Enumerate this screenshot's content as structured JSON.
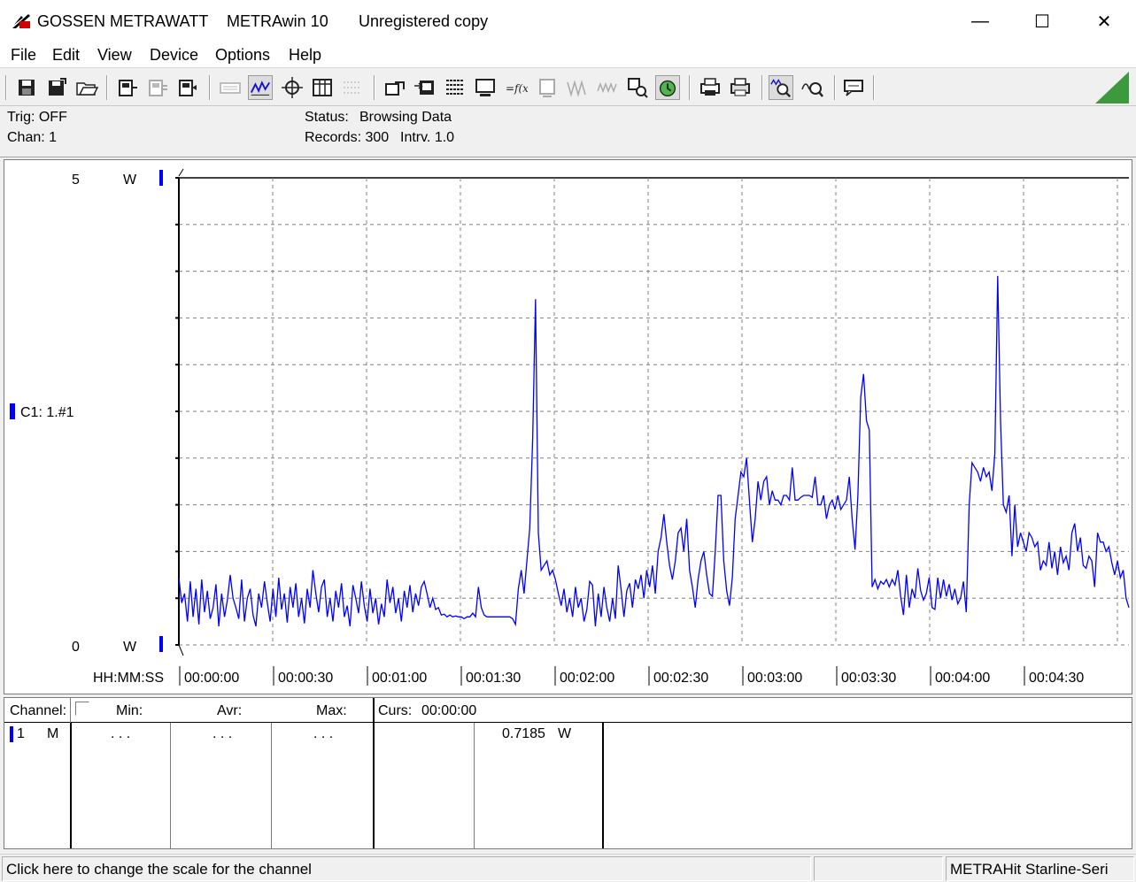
{
  "titlebar": {
    "brand": "GOSSEN METRAWATT",
    "app": "METRAwin 10",
    "registration": "Unregistered copy",
    "min_glyph": "—",
    "max_glyph": "☐",
    "close_glyph": "✕"
  },
  "menu": [
    "File",
    "Edit",
    "View",
    "Device",
    "Options",
    "Help"
  ],
  "info": {
    "trig": "Trig: OFF",
    "chan": "Chan:  1",
    "status_label": "Status:",
    "status_value": "Browsing Data",
    "records": "Records: 300",
    "interval": "Intrv. 1.0"
  },
  "chart": {
    "y_top_label": "5",
    "y_bottom_label": "0",
    "y_unit": "W",
    "channel_label": "C1: 1.#1",
    "x_axis_label": "HH:MM:SS"
  },
  "chart_data": {
    "type": "line",
    "ylabel": "W",
    "ylim": [
      0,
      5
    ],
    "xlim": [
      0,
      300
    ],
    "grid": true,
    "x_tick_labels": [
      "00:00:00",
      "00:00:30",
      "00:01:00",
      "00:01:30",
      "00:02:00",
      "00:02:30",
      "00:03:00",
      "00:03:30",
      "00:04:00",
      "00:04:30"
    ],
    "series": [
      {
        "name": "C1: 1.#1",
        "color": "#0000ff",
        "values": [
          0.72,
          0.45,
          0.55,
          0.25,
          0.68,
          0.3,
          0.6,
          0.22,
          0.7,
          0.35,
          0.58,
          0.28,
          0.4,
          0.65,
          0.2,
          0.55,
          0.3,
          0.48,
          0.75,
          0.5,
          0.4,
          0.28,
          0.7,
          0.25,
          0.5,
          0.6,
          0.32,
          0.2,
          0.55,
          0.4,
          0.68,
          0.45,
          0.25,
          0.6,
          0.3,
          0.72,
          0.38,
          0.55,
          0.24,
          0.62,
          0.4,
          0.66,
          0.3,
          0.5,
          0.23,
          0.6,
          0.4,
          0.8,
          0.55,
          0.35,
          0.62,
          0.7,
          0.3,
          0.5,
          0.25,
          0.58,
          0.4,
          0.66,
          0.3,
          0.42,
          0.2,
          0.64,
          0.5,
          0.34,
          0.68,
          0.42,
          0.25,
          0.6,
          0.34,
          0.5,
          0.22,
          0.44,
          0.3,
          0.7,
          0.45,
          0.62,
          0.34,
          0.5,
          0.25,
          0.58,
          0.4,
          0.64,
          0.35,
          0.55,
          0.42,
          0.62,
          0.68,
          0.55,
          0.4,
          0.5,
          0.38,
          0.4,
          0.32,
          0.33,
          0.3,
          0.32,
          0.3,
          0.31,
          0.3,
          0.3,
          0.28,
          0.3,
          0.3,
          0.34,
          0.3,
          0.62,
          0.4,
          0.32,
          0.3,
          0.3,
          0.3,
          0.3,
          0.3,
          0.3,
          0.3,
          0.3,
          0.3,
          0.28,
          0.22,
          0.6,
          0.8,
          0.55,
          0.9,
          1.25,
          2.2,
          3.7,
          1.2,
          0.8,
          0.85,
          0.9,
          0.75,
          0.8,
          0.7,
          0.55,
          0.42,
          0.6,
          0.35,
          0.5,
          0.3,
          0.62,
          0.4,
          0.5,
          0.25,
          0.38,
          0.68,
          0.64,
          0.2,
          0.55,
          0.3,
          0.62,
          0.4,
          0.25,
          0.5,
          0.28,
          0.85,
          0.6,
          0.3,
          0.58,
          0.66,
          0.4,
          0.7,
          0.6,
          0.75,
          0.5,
          0.8,
          0.62,
          0.85,
          0.55,
          1.0,
          1.15,
          1.4,
          1.1,
          0.85,
          0.7,
          0.9,
          1.2,
          1.25,
          1.0,
          1.35,
          0.8,
          0.62,
          0.4,
          0.7,
          0.9,
          1.0,
          0.75,
          0.55,
          0.52,
          1.0,
          1.6,
          1.6,
          0.9,
          0.58,
          0.42,
          0.72,
          1.35,
          1.6,
          1.85,
          1.8,
          2.0,
          1.55,
          1.1,
          1.35,
          1.75,
          1.55,
          1.75,
          1.8,
          1.5,
          1.65,
          1.55,
          1.55,
          1.5,
          1.6,
          1.6,
          1.55,
          1.9,
          1.55,
          1.55,
          1.58,
          1.6,
          1.6,
          1.6,
          1.58,
          1.8,
          1.5,
          1.5,
          1.6,
          1.35,
          1.5,
          1.55,
          1.45,
          1.6,
          1.45,
          1.5,
          1.55,
          1.8,
          1.35,
          1.02,
          1.6,
          2.65,
          2.9,
          2.4,
          2.3,
          0.62,
          0.7,
          0.6,
          0.68,
          0.65,
          0.7,
          0.62,
          0.7,
          0.64,
          0.8,
          0.52,
          0.32,
          0.75,
          0.4,
          0.6,
          0.5,
          0.82,
          0.58,
          0.48,
          0.55,
          0.72,
          0.4,
          0.38,
          0.72,
          0.5,
          0.7,
          0.52,
          0.65,
          0.48,
          0.6,
          0.44,
          0.5,
          0.68,
          0.35,
          1.5,
          1.95,
          1.9,
          1.85,
          1.75,
          1.9,
          1.8,
          1.85,
          1.65,
          2.05,
          3.95,
          2.4,
          1.5,
          1.42,
          1.6,
          0.95,
          1.5,
          1.05,
          1.2,
          1.1,
          1.0,
          1.2,
          1.15,
          1.05,
          1.1,
          0.8,
          0.9,
          0.85,
          1.1,
          0.82,
          1.0,
          0.75,
          1.05,
          0.88,
          0.95,
          0.8,
          1.2,
          1.3,
          1.0,
          1.15,
          0.85,
          0.82,
          0.95,
          0.9,
          0.62,
          1.2,
          1.1,
          1.1,
          1.0,
          1.05,
          0.88,
          0.75,
          0.9,
          0.72,
          0.8,
          0.5,
          0.4
        ]
      }
    ]
  },
  "table": {
    "channel_header": "Channel:",
    "min_header": "Min:",
    "avr_header": "Avr:",
    "max_header": "Max:",
    "curs_header": "Curs:",
    "curs_time": "00:00:00",
    "row": {
      "channel": "1",
      "mode": "M",
      "min": ". . .",
      "avr": ". . .",
      "max": ". . .",
      "cursor_value": "0.7185",
      "cursor_unit": "W"
    }
  },
  "statusbar": {
    "hint": "Click here to change the scale for the channel",
    "empty": "",
    "device": "METRAHit Starline-Seri"
  },
  "colors": {
    "trace": "#0000ff",
    "grid": "#808080",
    "accent_triangle": "#3c9a3c"
  },
  "toolbar_icons": [
    "save-icon",
    "save-as-icon",
    "open-folder-icon",
    "device-read-icon",
    "device-disabled-icon",
    "device-write-icon",
    "keyboard-disabled-icon",
    "trace-mode-icon",
    "crosshair-icon",
    "table-view-icon",
    "grid-disabled-icon",
    "export-icon",
    "import-icon",
    "list-icon",
    "monitor-icon",
    "formula-icon",
    "chip-disabled-icon",
    "wave-disabled-icon",
    "signal-disabled-icon",
    "search-device-icon",
    "start-recording-icon",
    "print-preview-icon",
    "print-icon",
    "zoom-in-icon",
    "zoom-out-icon",
    "comment-icon"
  ]
}
